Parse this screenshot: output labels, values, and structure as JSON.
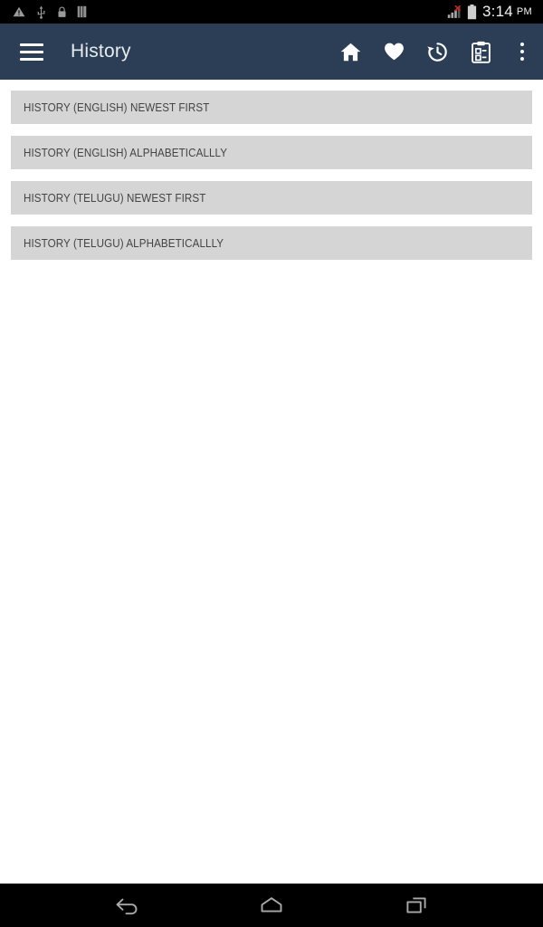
{
  "status_bar": {
    "left_icons": [
      {
        "name": "warning-icon",
        "label": "warning"
      },
      {
        "name": "usb-icon",
        "label": "usb"
      },
      {
        "name": "lock-icon",
        "label": "lock"
      },
      {
        "name": "vibrate-icon",
        "label": "vibrate"
      }
    ],
    "right_icons": [
      {
        "name": "signal-no-service-icon",
        "label": "signal"
      },
      {
        "name": "battery-icon",
        "label": "battery"
      }
    ],
    "time": "3:14",
    "ampm": "PM"
  },
  "app_bar": {
    "menu_label": "menu",
    "title": "History",
    "actions": [
      {
        "name": "home-icon",
        "label": "Home"
      },
      {
        "name": "favorites-heart-icon",
        "label": "Favorites"
      },
      {
        "name": "history-clock-icon",
        "label": "History"
      },
      {
        "name": "clipboard-notes-icon",
        "label": "Notes"
      }
    ],
    "overflow_label": "More options"
  },
  "list": {
    "items": [
      {
        "label": "HISTORY (ENGLISH) NEWEST FIRST"
      },
      {
        "label": "HISTORY (ENGLISH) ALPHABETICALLLY"
      },
      {
        "label": "HISTORY (TELUGU) NEWEST FIRST"
      },
      {
        "label": "HISTORY (TELUGU) ALPHABETICALLLY"
      }
    ]
  },
  "nav_bar": {
    "buttons": [
      {
        "name": "back-icon",
        "label": "Back"
      },
      {
        "name": "home-icon",
        "label": "Home"
      },
      {
        "name": "recents-icon",
        "label": "Recent apps"
      }
    ]
  },
  "colors": {
    "app_bar": "#2b3e55",
    "list_item": "#d5d5d5",
    "list_text": "#444444",
    "status_bar": "#000000",
    "nav_bar": "#000000",
    "background": "#ffffff"
  }
}
